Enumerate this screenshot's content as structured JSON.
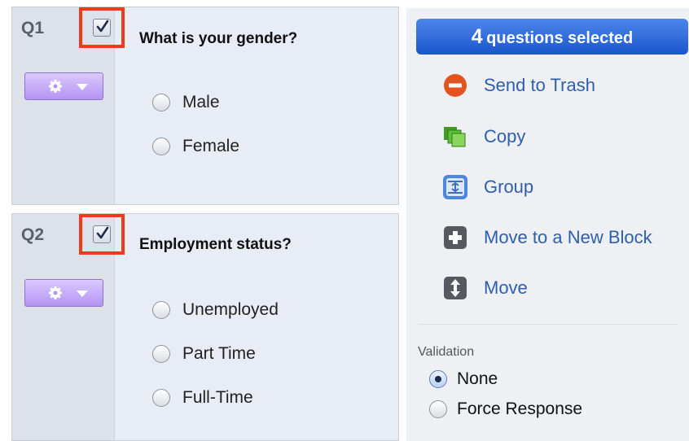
{
  "questions": [
    {
      "number": "Q1",
      "checked": true,
      "text": "What is your gender?",
      "choices": [
        "Male",
        "Female"
      ]
    },
    {
      "number": "Q2",
      "checked": true,
      "text": "Employment status?",
      "choices": [
        "Unemployed",
        "Part Time",
        "Full-Time"
      ]
    }
  ],
  "panel": {
    "selection": {
      "count": "4",
      "text": "questions selected"
    },
    "actions": [
      {
        "label": "Send to Trash",
        "icon": "trash-icon"
      },
      {
        "label": "Copy",
        "icon": "copy-icon"
      },
      {
        "label": "Group",
        "icon": "group-icon"
      },
      {
        "label": "Move to a New Block",
        "icon": "new-block-icon"
      },
      {
        "label": "Move",
        "icon": "move-icon"
      }
    ],
    "validation": {
      "label": "Validation",
      "options": [
        "None",
        "Force Response"
      ],
      "selected": "None"
    }
  },
  "colors": {
    "highlight_border": "#f2391c",
    "selection_bar": "#1a56cc",
    "action_link": "#2d5fae",
    "gear_button": "#b394f2"
  }
}
